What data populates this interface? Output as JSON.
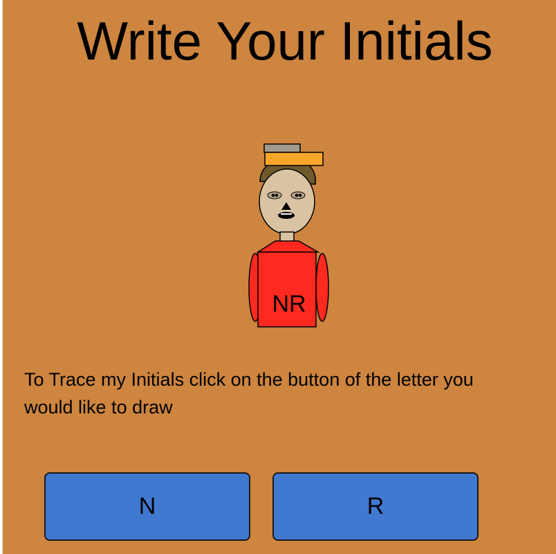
{
  "page": {
    "title": "Write Your Initials",
    "instructions": "To Trace my Initials click on the button of the letter you would like to draw"
  },
  "character": {
    "shirt_text": "NR"
  },
  "buttons": [
    {
      "label": "N"
    },
    {
      "label": "R"
    }
  ],
  "colors": {
    "background": "#cd853f",
    "button": "#4178d0",
    "shirt": "#ff2a1f",
    "hat_brim": "#f8a62a",
    "hat_top": "#a19a8c",
    "skin": "#d9c3a2",
    "hair": "#6f5a2c"
  }
}
